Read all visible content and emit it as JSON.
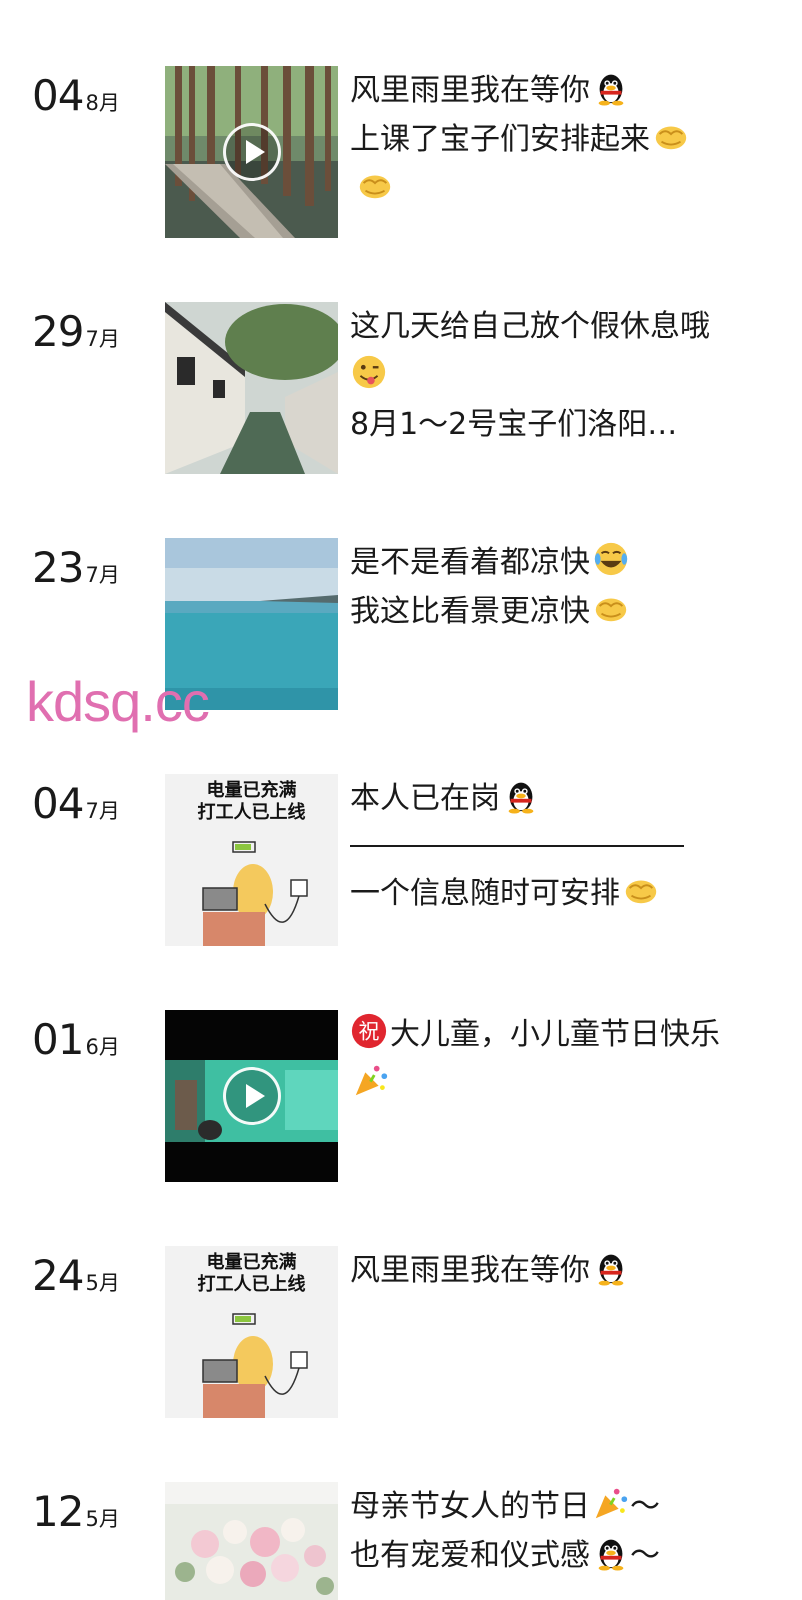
{
  "watermark": "kdsq.cc",
  "posts": [
    {
      "day": "04",
      "month": "8月",
      "has_video": true,
      "thumb": "forest-boardwalk",
      "lines": [
        "风里雨里我在等你",
        "上课了宝子们安排起来",
        ""
      ],
      "line_emojis": [
        [
          "penguin-emoji"
        ],
        [
          "fist-emoji"
        ],
        [
          "fist-emoji"
        ]
      ]
    },
    {
      "day": "29",
      "month": "7月",
      "has_video": false,
      "thumb": "water-town-canal",
      "lines": [
        "这几天给自己放个假休息哦",
        "",
        "8月1～2号宝子们洛阳…"
      ],
      "line_emojis": [
        [],
        [
          "wink-tongue-emoji"
        ],
        []
      ]
    },
    {
      "day": "23",
      "month": "7月",
      "has_video": false,
      "thumb": "lake-view",
      "lines": [
        "是不是看着都凉快",
        "我这比看景更凉快"
      ],
      "line_emojis": [
        [
          "laugh-cry-emoji"
        ],
        [
          "fist-emoji"
        ]
      ]
    },
    {
      "day": "04",
      "month": "7月",
      "has_video": false,
      "thumb": "worker-meme",
      "thumb_text": [
        "电量已充满",
        "打工人已上线"
      ],
      "lines": [
        "本人已在岗",
        "一个信息随时可安排"
      ],
      "line_emojis": [
        [
          "penguin-emoji"
        ],
        [
          "fist-emoji"
        ]
      ]
    },
    {
      "day": "01",
      "month": "6月",
      "has_video": true,
      "thumb": "dark-video",
      "lines": [
        "大儿童，小儿童节日快乐"
      ],
      "line_emojis": [
        [
          "blessing-emoji",
          "party-popper-emoji"
        ]
      ]
    },
    {
      "day": "24",
      "month": "5月",
      "has_video": false,
      "thumb": "worker-meme",
      "thumb_text": [
        "电量已充满",
        "打工人已上线"
      ],
      "lines": [
        "风里雨里我在等你"
      ],
      "line_emojis": [
        [
          "penguin-emoji"
        ]
      ]
    },
    {
      "day": "12",
      "month": "5月",
      "has_video": false,
      "thumb": "flower-bouquet",
      "lines": [
        "母亲节女人的节日",
        "～",
        "也有宠爱和仪式感",
        "～"
      ],
      "line_emojis": [
        [
          "party-popper-emoji"
        ],
        [],
        [
          "penguin-emoji"
        ],
        []
      ]
    }
  ]
}
